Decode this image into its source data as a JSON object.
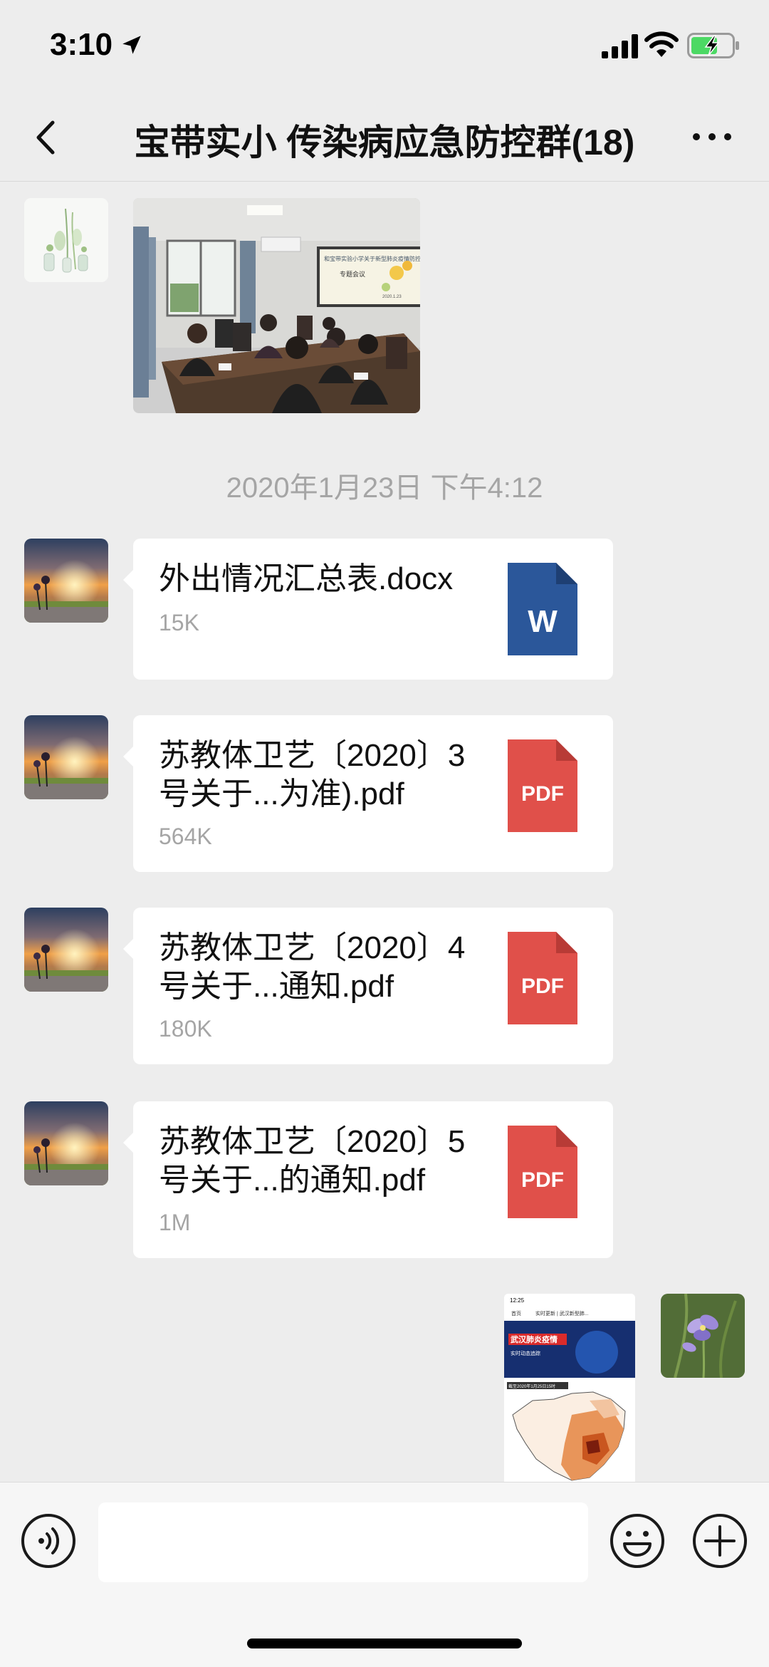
{
  "status_bar": {
    "time": "3:10"
  },
  "header": {
    "title": "宝带实小 传染病应急防控群(18)"
  },
  "messages": {
    "timestamp": "2020年1月23日 下午4:12",
    "photo1": {
      "poster_title": "和宝带实验小学关于新型肺炎疫情防控工作",
      "poster_subtitle": "专题会议",
      "poster_footer": "2020.1.23"
    },
    "files": [
      {
        "name": "外出情况汇总表.docx",
        "size": "15K",
        "type_label": "W",
        "color": "#2b579a"
      },
      {
        "name": "苏教体卫艺〔2020〕3号关于...为准).pdf",
        "size": "564K",
        "type_label": "PDF",
        "color": "#e0504a"
      },
      {
        "name": "苏教体卫艺〔2020〕4号关于...通知.pdf",
        "size": "180K",
        "type_label": "PDF",
        "color": "#e0504a"
      },
      {
        "name": "苏教体卫艺〔2020〕5号关于...的通知.pdf",
        "size": "1M",
        "type_label": "PDF",
        "color": "#e0504a"
      }
    ],
    "screenshot_msg": {
      "time": "12:25",
      "nav": "实时更新 | 武汉新型肺...",
      "back": "首页",
      "banner": "武汉肺炎疫情",
      "banner_sub": "实时动态追踪",
      "map_caption": "截至2020年1月25日15时"
    }
  },
  "input": {
    "placeholder": ""
  }
}
